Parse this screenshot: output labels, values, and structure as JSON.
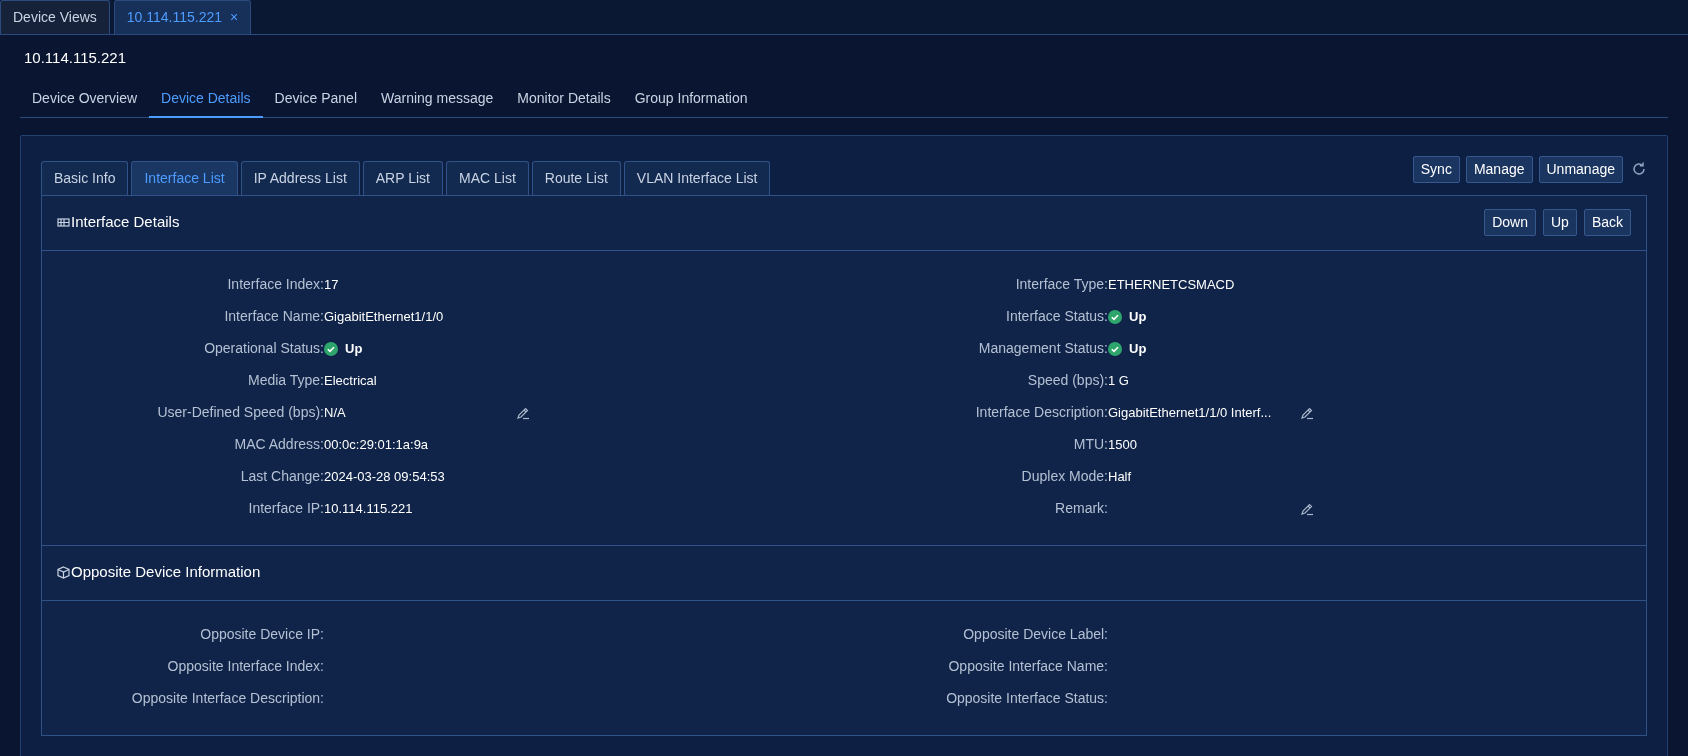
{
  "window_tabs": [
    {
      "label": "Device Views",
      "selected": false
    },
    {
      "label": "10.114.115.221",
      "selected": true,
      "close": "×"
    }
  ],
  "title": "10.114.115.221",
  "nav_tabs": [
    {
      "label": "Device Overview",
      "selected": false
    },
    {
      "label": "Device Details",
      "selected": true
    },
    {
      "label": "Device Panel",
      "selected": false
    },
    {
      "label": "Warning message",
      "selected": false
    },
    {
      "label": "Monitor Details",
      "selected": false
    },
    {
      "label": "Group Information",
      "selected": false
    }
  ],
  "sub_tabs": [
    {
      "label": "Basic Info",
      "selected": false
    },
    {
      "label": "Interface List",
      "selected": true
    },
    {
      "label": "IP Address List",
      "selected": false
    },
    {
      "label": "ARP List",
      "selected": false
    },
    {
      "label": "MAC List",
      "selected": false
    },
    {
      "label": "Route List",
      "selected": false
    },
    {
      "label": "VLAN Interface List",
      "selected": false
    }
  ],
  "toolbar_buttons": [
    "Sync",
    "Manage",
    "Unmanage"
  ],
  "sections": [
    {
      "kind": "interface",
      "title": "Interface Details",
      "buttons": [
        "Down",
        "Up",
        "Back"
      ],
      "left": [
        {
          "label": "Interface Index:",
          "value": "17",
          "kind": "text",
          "editable": false
        },
        {
          "label": "Interface Name:",
          "value": "GigabitEthernet1/1/0",
          "kind": "text",
          "editable": false
        },
        {
          "label": "Operational Status:",
          "value": "Up",
          "kind": "status",
          "ok": true,
          "editable": false
        },
        {
          "label": "Media Type:",
          "value": "Electrical",
          "kind": "text",
          "editable": false
        },
        {
          "label": "User-Defined Speed (bps):",
          "value": "N/A",
          "kind": "text",
          "editable": true
        },
        {
          "label": "MAC Address:",
          "value": "00:0c:29:01:1a:9a",
          "kind": "text",
          "editable": false
        },
        {
          "label": "Last Change:",
          "value": "2024-03-28 09:54:53",
          "kind": "text",
          "editable": false
        },
        {
          "label": "Interface IP:",
          "value": "10.114.115.221",
          "kind": "text",
          "editable": false
        }
      ],
      "right": [
        {
          "label": "Interface Type:",
          "value": "ETHERNETCSMACD",
          "kind": "text",
          "editable": false
        },
        {
          "label": "Interface Status:",
          "value": "Up",
          "kind": "status",
          "ok": true,
          "editable": false
        },
        {
          "label": "Management Status:",
          "value": "Up",
          "kind": "status",
          "ok": true,
          "editable": false
        },
        {
          "label": "Speed (bps):",
          "value": "1 G",
          "kind": "text",
          "editable": false
        },
        {
          "label": "Interface Description:",
          "value": "GigabitEthernet1/1/0 Interf...",
          "kind": "text",
          "editable": true
        },
        {
          "label": "MTU:",
          "value": "1500",
          "kind": "text",
          "editable": false
        },
        {
          "label": "Duplex Mode:",
          "value": "Half",
          "kind": "text",
          "editable": false
        },
        {
          "label": "Remark:",
          "kind": "text",
          "editable": true
        }
      ]
    },
    {
      "kind": "opposite",
      "title": "Opposite Device Information",
      "left": [
        {
          "label": "Opposite Device IP:",
          "kind": "text",
          "editable": false
        },
        {
          "label": "Opposite Interface Index:",
          "kind": "text",
          "editable": false
        },
        {
          "label": "Opposite Interface Description:",
          "kind": "text",
          "editable": false
        }
      ],
      "right": [
        {
          "label": "Opposite Device Label:",
          "kind": "text",
          "editable": false
        },
        {
          "label": "Opposite Interface Name:",
          "kind": "text",
          "editable": false
        },
        {
          "label": "Opposite Interface Status:",
          "kind": "text",
          "editable": false
        }
      ]
    }
  ]
}
